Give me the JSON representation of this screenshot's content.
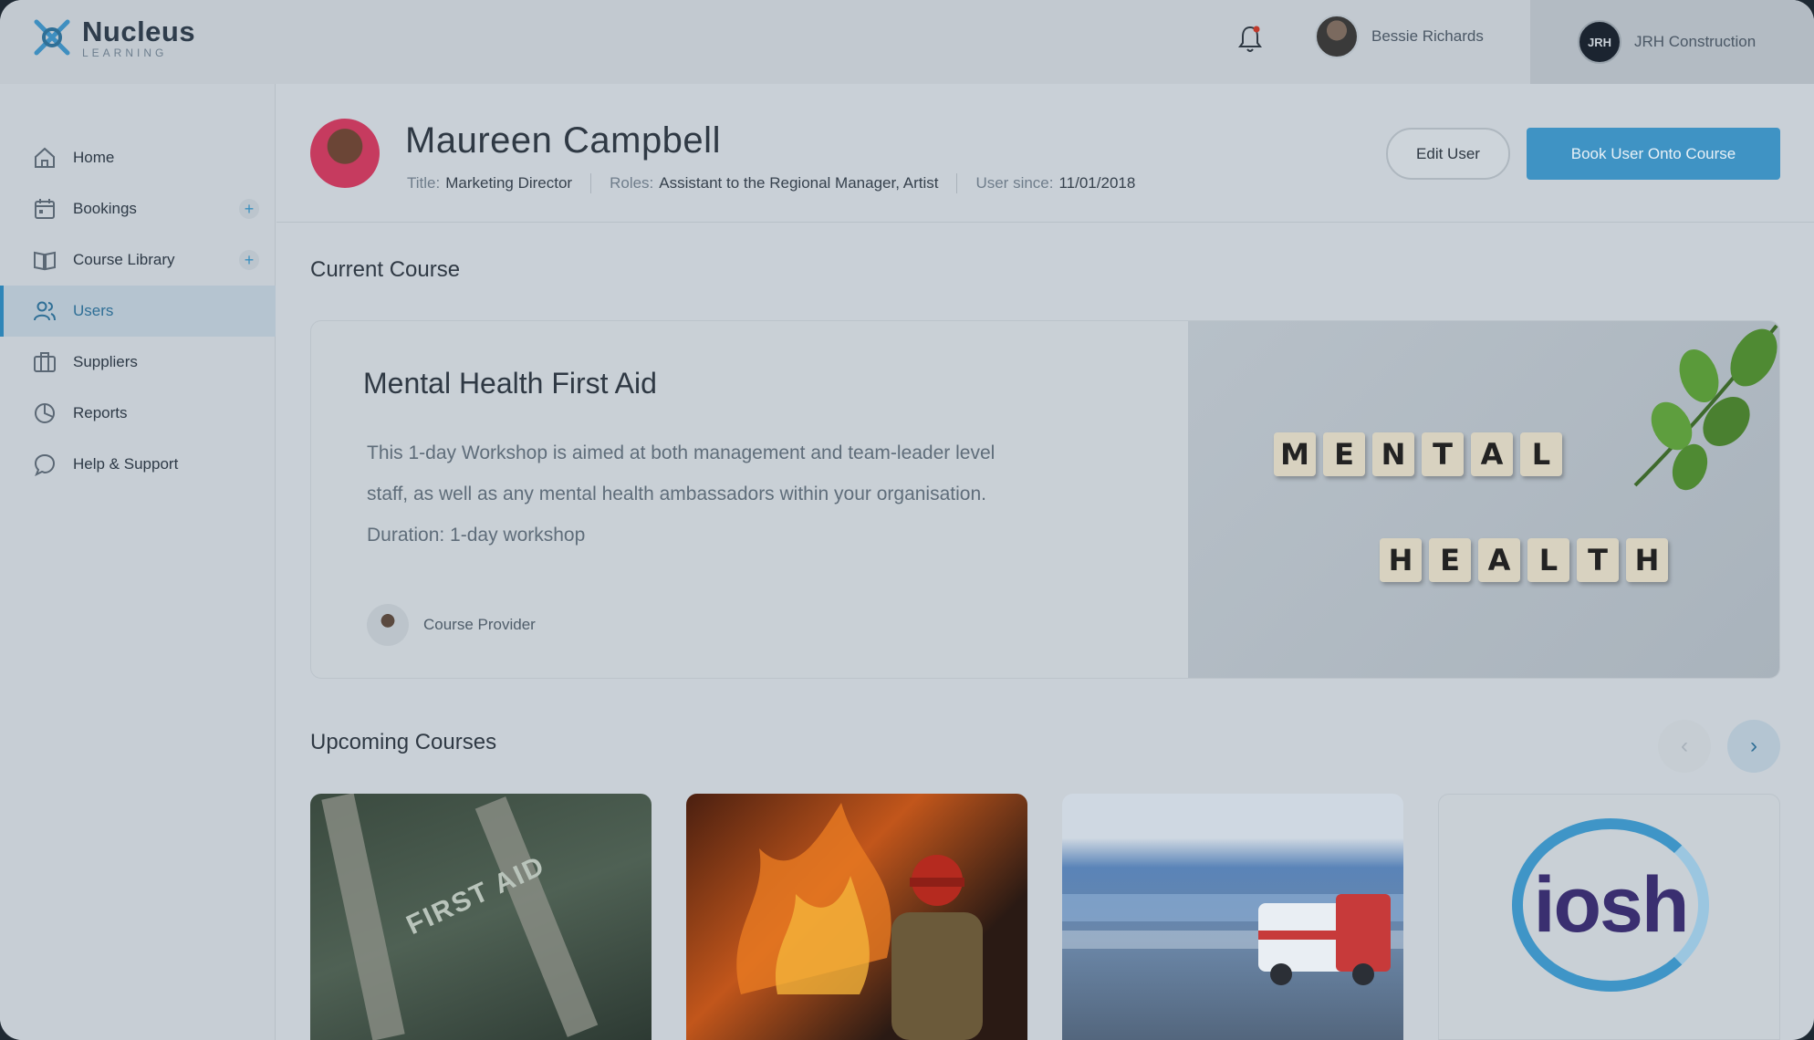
{
  "brand": {
    "name": "Nucleus",
    "sub": "LEARNING"
  },
  "header": {
    "user_name": "Bessie Richards",
    "company_name": "JRH Construction",
    "company_logo_text": "JRH"
  },
  "sidebar": {
    "items": [
      {
        "label": "Home",
        "icon": "home-icon"
      },
      {
        "label": "Bookings",
        "icon": "calendar-icon"
      },
      {
        "label": "Course Library",
        "icon": "book-icon"
      },
      {
        "label": "Users",
        "icon": "users-icon"
      },
      {
        "label": "Suppliers",
        "icon": "briefcase-icon"
      },
      {
        "label": "Reports",
        "icon": "pie-chart-icon"
      },
      {
        "label": "Help & Support",
        "icon": "chat-bubble-icon"
      }
    ],
    "plus_symbol": "+"
  },
  "profile": {
    "name": "Maureen Campbell",
    "title_label": "Title:",
    "title_value": "Marketing Director",
    "roles_label": "Roles:",
    "roles_value": "Assistant to the Regional Manager, Artist",
    "since_label": "User since:",
    "since_value": "11/01/2018",
    "edit_button": "Edit User",
    "book_button": "Book User Onto Course"
  },
  "current_course": {
    "section_title": "Current Course",
    "title": "Mental Health First Aid",
    "description_line1": "This 1-day Workshop is aimed at both management and team-leader level",
    "description_line2": "staff, as well as any mental health ambassadors within your organisation.",
    "duration": "Duration: 1-day workshop",
    "provider": "Course Provider",
    "image_word1": [
      "M",
      "E",
      "N",
      "T",
      "A",
      "L"
    ],
    "image_word2": [
      "H",
      "E",
      "A",
      "L",
      "T",
      "H"
    ]
  },
  "upcoming": {
    "section_title": "Upcoming Courses",
    "prev_symbol": "‹",
    "next_symbol": "›",
    "card1_text": "FIRST AID",
    "card4_logo": "iosh"
  },
  "colors": {
    "accent": "#3f93c4",
    "active_nav": "#2f86b8"
  }
}
